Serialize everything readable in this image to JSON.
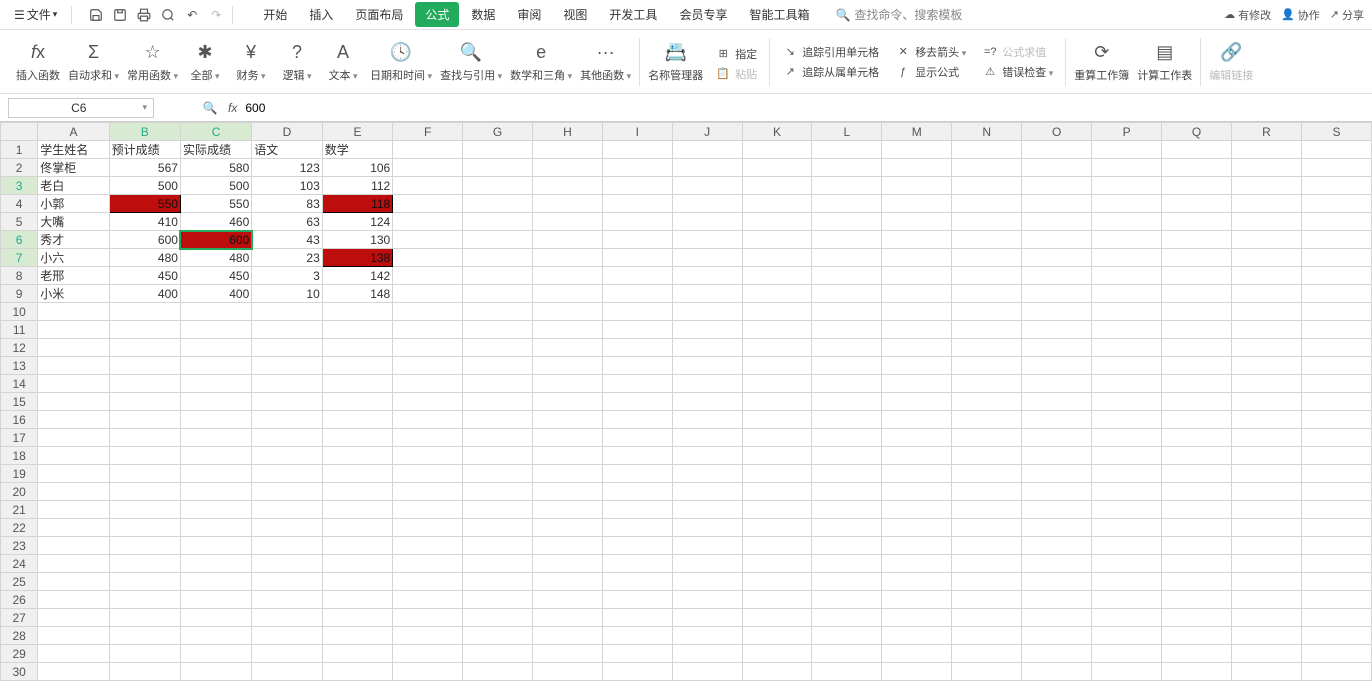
{
  "menubar": {
    "file_label": "文件",
    "tabs": [
      "开始",
      "插入",
      "页面布局",
      "公式",
      "数据",
      "审阅",
      "视图",
      "开发工具",
      "会员专享",
      "智能工具箱"
    ],
    "active_tab_index": 3,
    "search_placeholder": "查找命令、搜索模板",
    "right_items": [
      "有修改",
      "协作",
      "分享"
    ]
  },
  "ribbon": {
    "insert_fn": "插入函数",
    "auto_sum": "自动求和",
    "common_fn": "常用函数",
    "all": "全部",
    "finance": "财务",
    "logic": "逻辑",
    "text": "文本",
    "datetime": "日期和时间",
    "lookup": "查找与引用",
    "math": "数学和三角",
    "other_fn": "其他函数",
    "more": "···",
    "name_mgr": "名称管理器",
    "define": "指定",
    "paste": "粘贴",
    "trace_prec": "追踪引用单元格",
    "trace_dep": "追踪从属单元格",
    "remove_arrows": "移去箭头",
    "show_formula": "显示公式",
    "formula_eval": "公式求值",
    "error_check": "错误检查",
    "recalc_wb": "重算工作簿",
    "calc_ws": "计算工作表",
    "edit_links": "编辑链接"
  },
  "formula_bar": {
    "name_box": "C6",
    "formula": "600"
  },
  "grid": {
    "cols": [
      "A",
      "B",
      "C",
      "D",
      "E",
      "F",
      "G",
      "H",
      "I",
      "J",
      "K",
      "L",
      "M",
      "N",
      "O",
      "P",
      "Q",
      "R",
      "S"
    ],
    "row_count": 30,
    "active_cell": {
      "row": 6,
      "col": 2
    },
    "sel_cols": [
      1,
      2
    ],
    "sel_rows": [
      3,
      6,
      7
    ],
    "headers": {
      "A": "学生姓名",
      "B": "预计成绩",
      "C": "实际成绩",
      "D": "语文",
      "E": "数学"
    },
    "rows": [
      {
        "r": 2,
        "A": "佟掌柜",
        "B": 567,
        "C": 580,
        "D": 123,
        "E": 106
      },
      {
        "r": 3,
        "A": "老白",
        "B": 500,
        "C": 500,
        "D": 103,
        "E": 112
      },
      {
        "r": 4,
        "A": "小郭",
        "B": 550,
        "C": 550,
        "D": 83,
        "E": 118
      },
      {
        "r": 5,
        "A": "大嘴",
        "B": 410,
        "C": 460,
        "D": 63,
        "E": 124
      },
      {
        "r": 6,
        "A": "秀才",
        "B": 600,
        "C": 600,
        "D": 43,
        "E": 130
      },
      {
        "r": 7,
        "A": "小六",
        "B": 480,
        "C": 480,
        "D": 23,
        "E": 138
      },
      {
        "r": 8,
        "A": "老邢",
        "B": 450,
        "C": 450,
        "D": 3,
        "E": 142
      },
      {
        "r": 9,
        "A": "小米",
        "B": 400,
        "C": 400,
        "D": 10,
        "E": 148
      }
    ],
    "red_cells": [
      "B4",
      "E4",
      "C6",
      "E7"
    ]
  }
}
